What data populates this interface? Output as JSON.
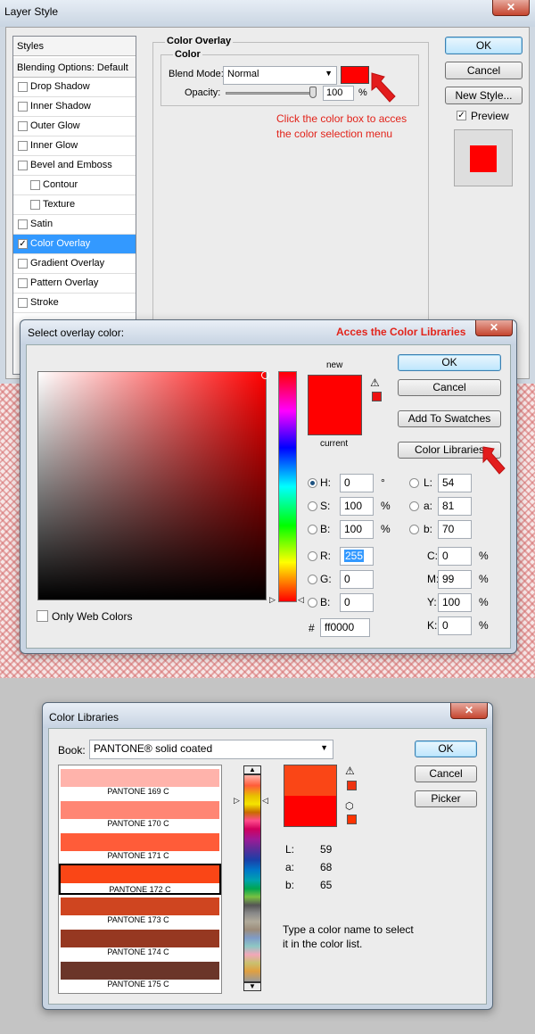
{
  "layer_style": {
    "title": "Layer Style",
    "styles_header": "Styles",
    "blending": "Blending Options: Default",
    "items": [
      {
        "label": "Drop Shadow",
        "checked": false
      },
      {
        "label": "Inner Shadow",
        "checked": false
      },
      {
        "label": "Outer Glow",
        "checked": false
      },
      {
        "label": "Inner Glow",
        "checked": false
      },
      {
        "label": "Bevel and Emboss",
        "checked": false
      },
      {
        "label": "Contour",
        "checked": false
      },
      {
        "label": "Texture",
        "checked": false
      },
      {
        "label": "Satin",
        "checked": false
      },
      {
        "label": "Color Overlay",
        "checked": true
      },
      {
        "label": "Gradient Overlay",
        "checked": false
      },
      {
        "label": "Pattern Overlay",
        "checked": false
      },
      {
        "label": "Stroke",
        "checked": false
      }
    ],
    "group_title": "Color Overlay",
    "sub_title": "Color",
    "blend_mode_label": "Blend Mode:",
    "blend_mode_value": "Normal",
    "opacity_label": "Opacity:",
    "opacity_value": "100",
    "opacity_unit": "%",
    "ok": "OK",
    "cancel": "Cancel",
    "new_style": "New Style...",
    "preview": "Preview",
    "annotation_line1": "Click the color box to acces",
    "annotation_line2": "the color selection menu",
    "overlay_color": "#ff0000"
  },
  "color_picker": {
    "title": "Select overlay color:",
    "annotation": "Acces the Color Libraries",
    "new_label": "new",
    "current_label": "current",
    "ok": "OK",
    "cancel": "Cancel",
    "add_swatches": "Add To Swatches",
    "color_libraries": "Color Libraries",
    "only_web": "Only Web Colors",
    "fields": {
      "H": "0",
      "S": "100",
      "B": "100",
      "R": "255",
      "G": "0",
      "Bv": "0",
      "L": "54",
      "a": "81",
      "b": "70",
      "C": "0",
      "M": "99",
      "Y": "100",
      "K": "0",
      "hex": "ff0000"
    },
    "labels": {
      "H": "H:",
      "S": "S:",
      "B": "B:",
      "R": "R:",
      "G": "G:",
      "Bv": "B:",
      "L": "L:",
      "a": "a:",
      "b": "b:",
      "C": "C:",
      "M": "M:",
      "Y": "Y:",
      "K": "K:",
      "hash": "#",
      "deg": "°",
      "pct": "%"
    }
  },
  "color_libraries": {
    "title": "Color Libraries",
    "book_label": "Book:",
    "book_value": "PANTONE® solid coated",
    "ok": "OK",
    "cancel": "Cancel",
    "picker": "Picker",
    "swatches": [
      {
        "name": "PANTONE 169 C",
        "color": "#ffb3ab"
      },
      {
        "name": "PANTONE 170 C",
        "color": "#ff8674"
      },
      {
        "name": "PANTONE 171 C",
        "color": "#ff5c39"
      },
      {
        "name": "PANTONE 172 C",
        "color": "#fa4616",
        "selected": true
      },
      {
        "name": "PANTONE 173 C",
        "color": "#cf4520"
      },
      {
        "name": "PANTONE 174 C",
        "color": "#963821"
      },
      {
        "name": "PANTONE 175 C",
        "color": "#6b3529"
      }
    ],
    "lab": {
      "L_label": "L:",
      "L": "59",
      "a_label": "a:",
      "a": "68",
      "b_label": "b:",
      "b": "65"
    },
    "hint": "Type a color name to select it in the color list.",
    "new_color": "#fa4616",
    "current_color": "#ff0000"
  }
}
